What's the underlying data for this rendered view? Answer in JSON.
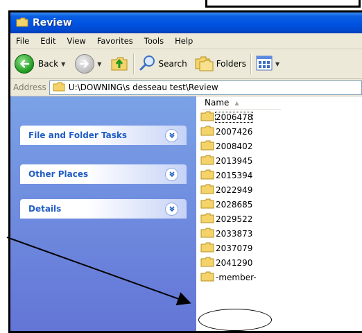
{
  "window": {
    "title": "Review"
  },
  "menu": {
    "items": [
      "File",
      "Edit",
      "View",
      "Favorites",
      "Tools",
      "Help"
    ]
  },
  "toolbar": {
    "back_label": "Back",
    "search_label": "Search",
    "folders_label": "Folders"
  },
  "address": {
    "label": "Address",
    "value": "U:\\DOWNING\\s desseau test\\Review"
  },
  "task_pane": {
    "groups": [
      {
        "label": "File and Folder Tasks"
      },
      {
        "label": "Other Places"
      },
      {
        "label": "Details"
      }
    ]
  },
  "file_pane": {
    "column_header": "Name",
    "items": [
      "2006478",
      "2007426",
      "2008402",
      "2013945",
      "2015394",
      "2022949",
      "2028685",
      "2029522",
      "2033873",
      "2037079",
      "2041290",
      "-member-"
    ]
  },
  "colors": {
    "titlebar": "#0054e3",
    "task_pane": "#7ba2e7",
    "task_label": "#215dc6",
    "folder": "#f4d36b"
  }
}
